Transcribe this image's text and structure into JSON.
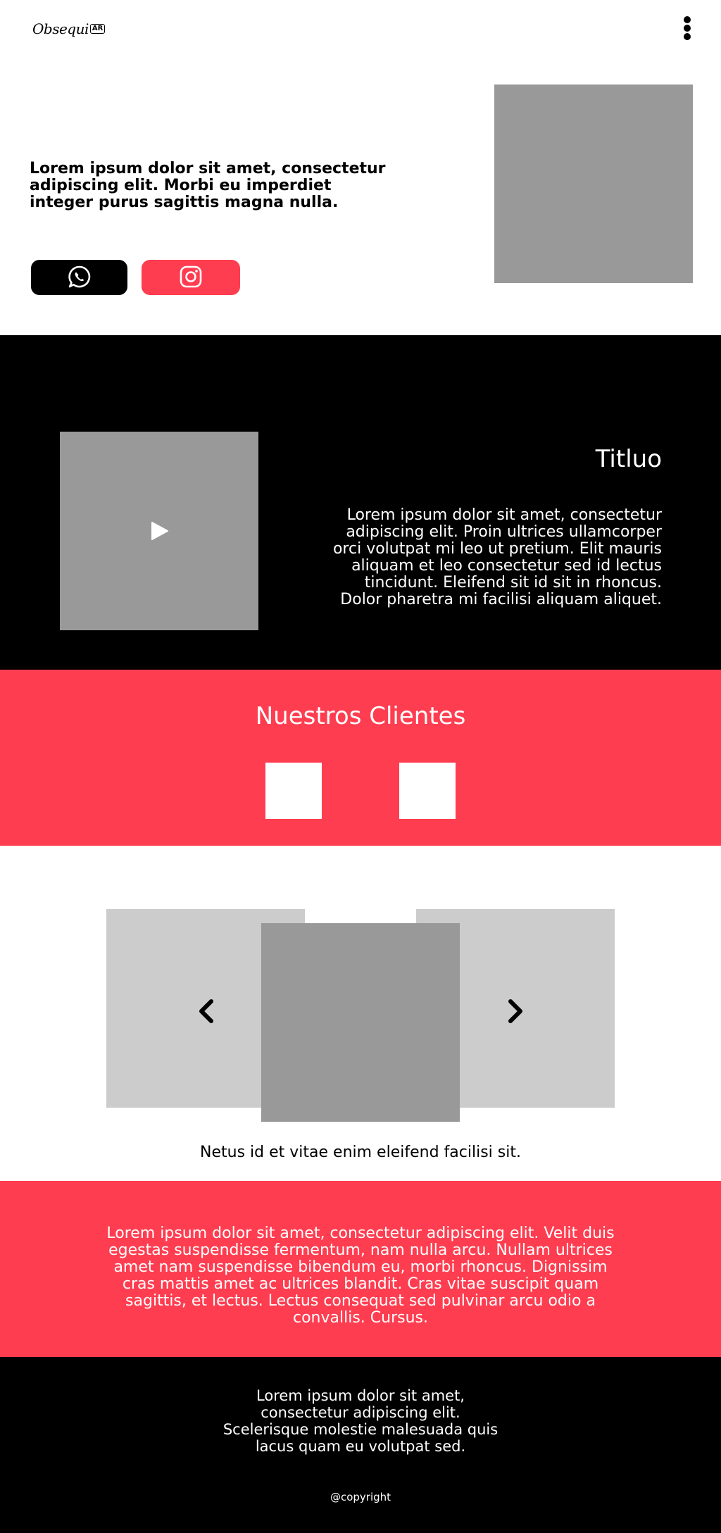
{
  "header": {
    "logo_text": "Obsequi",
    "logo_badge": "AR",
    "menu_icon": "kebab-menu-icon"
  },
  "hero": {
    "text": "Lorem ipsum dolor sit amet, consectetur adipiscing elit. Morbi eu imperdiet integer purus sagittis magna nulla.",
    "buttons": [
      {
        "icon": "whatsapp-icon",
        "color": "#000000"
      },
      {
        "icon": "instagram-icon",
        "color": "#ff3d50"
      }
    ]
  },
  "video_section": {
    "title": "Titluo",
    "text": "Lorem ipsum dolor sit amet, consectetur adipiscing elit. Proin ultrices ullamcorper orci volutpat mi leo ut pretium. Elit mauris aliquam et leo consectetur sed id lectus tincidunt. Eleifend sit id sit in rhoncus. Dolor pharetra mi facilisi aliquam aliquet.",
    "play_icon": "play-icon"
  },
  "clients": {
    "title": "Nuestros Clientes"
  },
  "carousel": {
    "caption": "Netus id et vitae enim eleifend facilisi sit.",
    "prev_icon": "chevron-left-icon",
    "next_icon": "chevron-right-icon"
  },
  "info_section": {
    "text": "Lorem ipsum dolor sit amet, consectetur adipiscing elit. Velit duis egestas suspendisse fermentum, nam nulla arcu. Nullam ultrices amet nam suspendisse bibendum eu, morbi rhoncus. Dignissim cras mattis amet ac ultrices blandit. Cras vitae suscipit quam sagittis, et lectus. Lectus consequat sed pulvinar arcu odio a convallis. Cursus."
  },
  "footer": {
    "text": "Lorem ipsum dolor sit amet, consectetur adipiscing elit. Scelerisque molestie malesuada quis lacus quam eu volutpat sed.",
    "copyright": "@copyright"
  },
  "colors": {
    "accent": "#ff3d50",
    "dark": "#000000",
    "placeholder": "#999999",
    "placeholder_light": "#cccccc"
  }
}
